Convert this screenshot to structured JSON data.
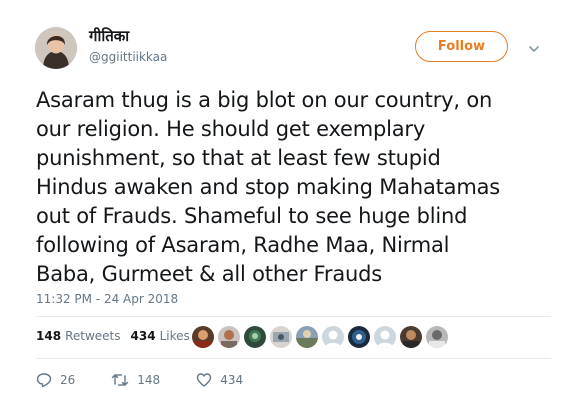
{
  "user": {
    "display_name": "गीतिका",
    "handle": "@ggiittiikkaa",
    "avatar_icon": "profile-photo"
  },
  "follow_label": "Follow",
  "colors": {
    "follow_accent": "#e67e22",
    "muted": "#657786"
  },
  "tweet": {
    "text": "Asaram thug is a big blot on our country, on\nour religion. He should get exemplary\npunishment, so that at least few stupid\nHindus awaken and stop making Mahatamas\nout of Frauds. Shameful to see huge blind\nfollowing of Asaram, Radhe Maa, Nirmal\nBaba, Gurmeet & all other Frauds",
    "timestamp": "11:32 PM - 24 Apr 2018"
  },
  "stats": {
    "retweets_count": "148",
    "retweets_label": "Retweets",
    "likes_count": "434",
    "likes_label": "Likes"
  },
  "actions": {
    "reply_count": "26",
    "retweet_count": "148",
    "like_count": "434"
  }
}
